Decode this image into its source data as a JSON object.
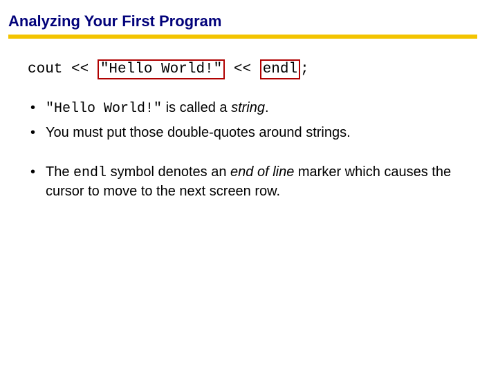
{
  "title": "Analyzing Your First Program",
  "code": {
    "p1": "cout << ",
    "str": "\"Hello World!\"",
    "p2": " << ",
    "endl": "endl",
    "p3": ";"
  },
  "bullets": {
    "b1": {
      "code": "\"Hello World!\"",
      "t1": " is called a ",
      "em": "string",
      "t2": "."
    },
    "b2": "You must put those double-quotes around strings.",
    "b3": {
      "t1": "The ",
      "code": "endl",
      "t2": " symbol denotes an ",
      "em": "end of line",
      "t3": " marker which causes the cursor to move to the next screen row."
    }
  }
}
